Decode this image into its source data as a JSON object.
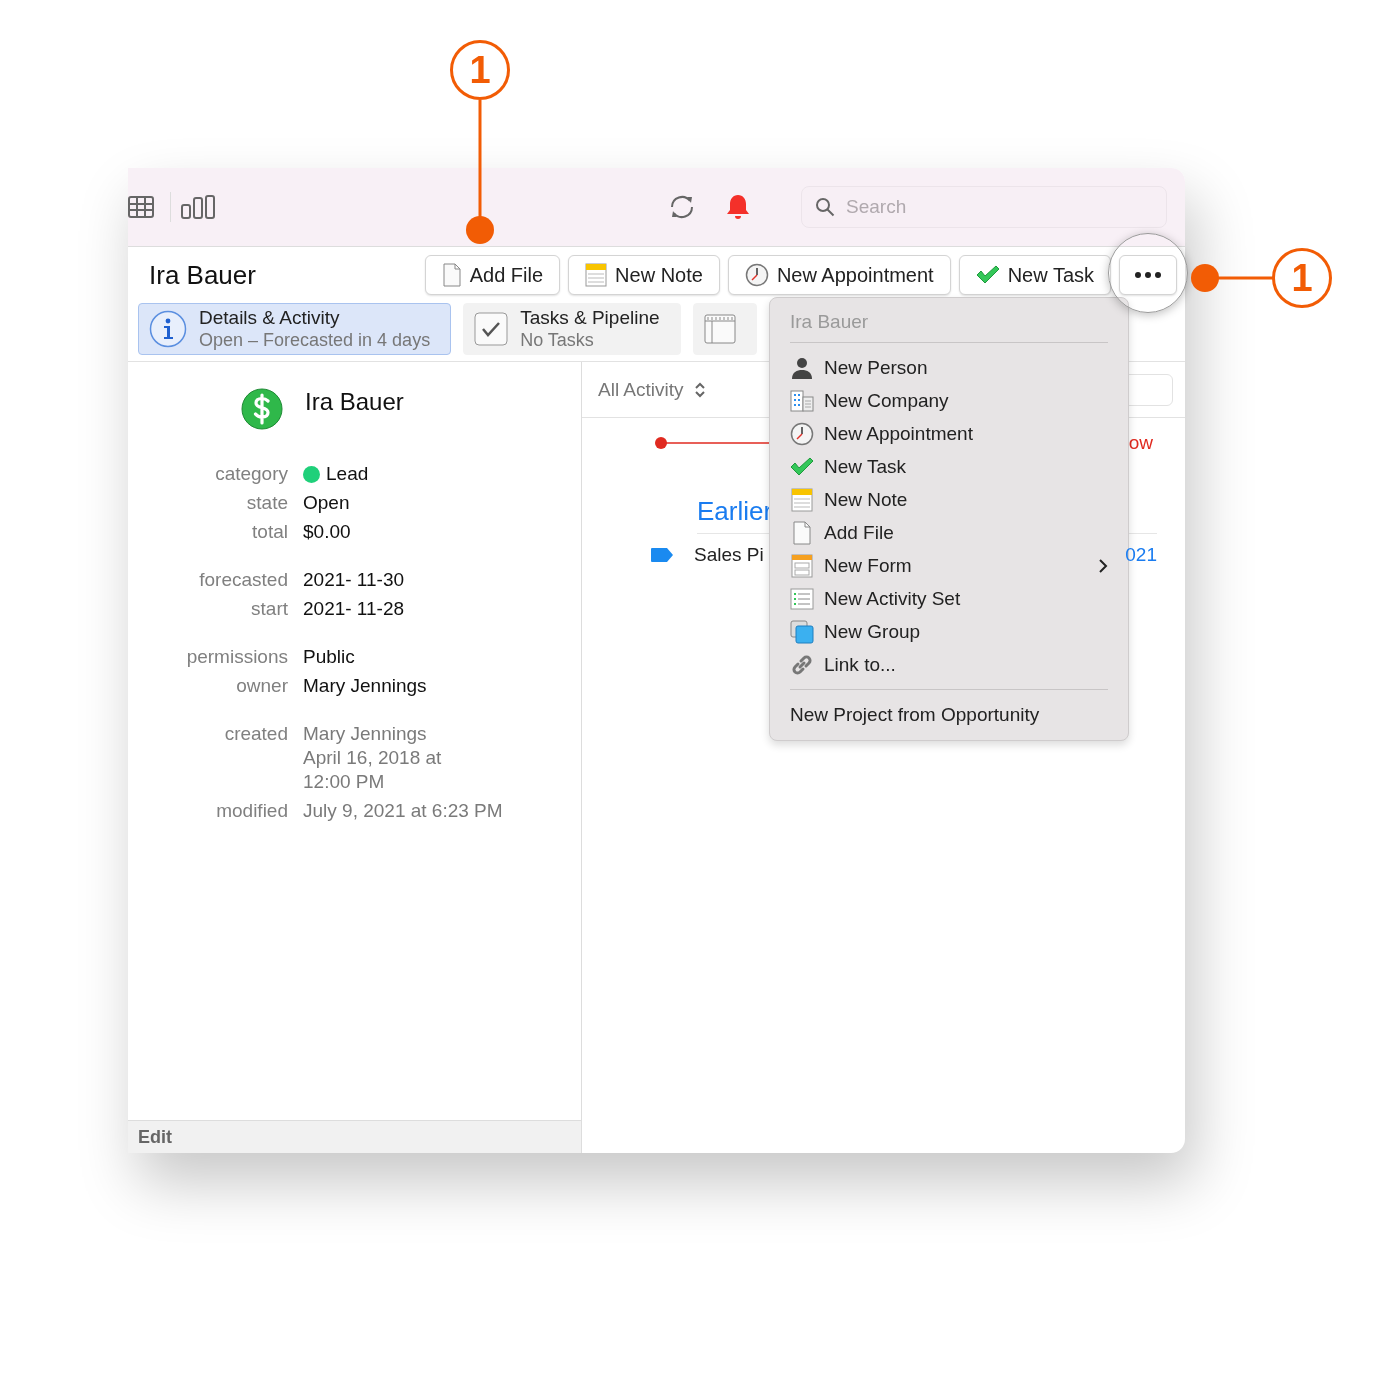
{
  "toolbar": {
    "search": {
      "placeholder": "Search"
    }
  },
  "header": {
    "title": "Ira Bauer",
    "buttons": [
      {
        "kind": "file",
        "label": "Add File"
      },
      {
        "kind": "note",
        "label": "New Note"
      },
      {
        "kind": "appointment",
        "label": "New Appointment"
      },
      {
        "kind": "task",
        "label": "New Task"
      },
      {
        "kind": "more"
      }
    ]
  },
  "tabs": [
    {
      "kind": "info",
      "title": "Details & Activity",
      "subtitle": "Open – Forecasted in 4 days",
      "selected": true
    },
    {
      "kind": "tasks",
      "title": "Tasks & Pipeline",
      "subtitle": "No Tasks",
      "selected": false
    },
    {
      "kind": "calendar",
      "selected": false
    }
  ],
  "details": {
    "name": "Ira Bauer",
    "groups": [
      [
        {
          "label": "category",
          "lines": [
            "Lead"
          ],
          "color": "#1fd07a"
        },
        {
          "label": "state",
          "lines": [
            "Open"
          ]
        },
        {
          "label": "total",
          "lines": [
            "$0.00"
          ]
        }
      ],
      [
        {
          "label": "forecasted",
          "lines": [
            "2021- 11-30"
          ]
        },
        {
          "label": "start",
          "lines": [
            "2021- 11-28"
          ]
        }
      ],
      [
        {
          "label": "permissions",
          "lines": [
            "Public"
          ]
        },
        {
          "label": "owner",
          "lines": [
            "Mary Jennings"
          ]
        }
      ],
      [
        {
          "label": "created",
          "lines": [
            "Mary Jennings",
            "April 16, 2018 at",
            "12:00 PM"
          ],
          "muted": true
        },
        {
          "label": "modified",
          "lines": [
            "July 9, 2021 at 6:23 PM"
          ],
          "muted": true
        }
      ]
    ],
    "footer": "Edit"
  },
  "activity": {
    "filter": "All Activity",
    "now_label": "ow",
    "section": "Earlier",
    "rows": [
      {
        "title": "Sales Pi",
        "date": "021"
      }
    ]
  },
  "menu": {
    "header": "Ira Bauer",
    "items": [
      {
        "kind": "person",
        "label": "New Person",
        "submenu": false
      },
      {
        "kind": "company",
        "label": "New Company",
        "submenu": false
      },
      {
        "kind": "appointment",
        "label": "New Appointment",
        "submenu": false
      },
      {
        "kind": "task",
        "label": "New Task",
        "submenu": false
      },
      {
        "kind": "note",
        "label": "New Note",
        "submenu": false
      },
      {
        "kind": "file",
        "label": "Add File",
        "submenu": false
      },
      {
        "kind": "form",
        "label": "New Form",
        "submenu": true
      },
      {
        "kind": "activityset",
        "label": "New Activity Set",
        "submenu": false
      },
      {
        "kind": "group",
        "label": "New Group",
        "submenu": false
      },
      {
        "kind": "link",
        "label": "Link to...",
        "submenu": false
      }
    ],
    "footer": "New Project from Opportunity"
  },
  "callouts": [
    {
      "label": "1"
    },
    {
      "label": "1"
    }
  ]
}
